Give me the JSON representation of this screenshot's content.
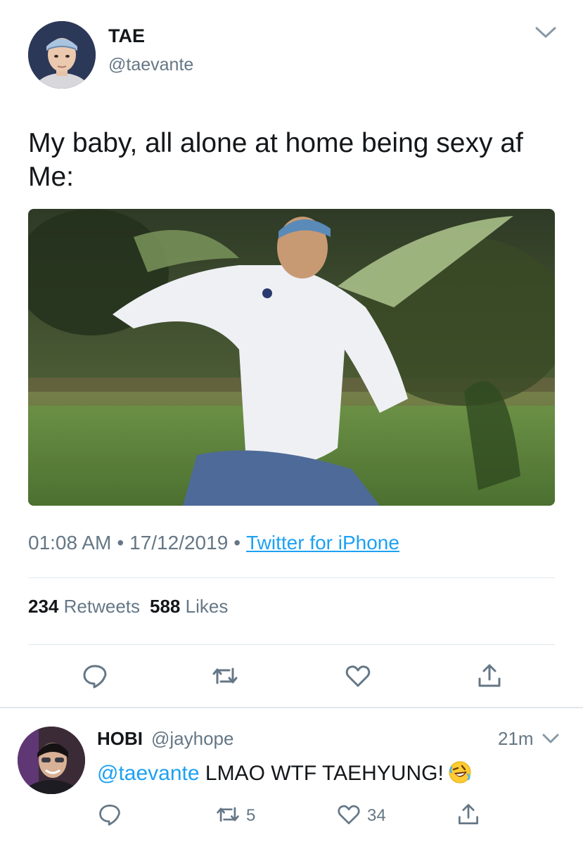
{
  "tweet": {
    "author_name": "TAE",
    "author_handle": "@taevante",
    "text_lines": [
      "My baby, all alone at home being sexy af",
      "Me:"
    ],
    "time": "01:08 AM",
    "separator": "•",
    "date": "17/12/2019",
    "source": "Twitter for iPhone",
    "retweet_count": "234",
    "retweet_label": "Retweets",
    "like_count": "588",
    "like_label": "Likes",
    "actions": [
      "reply-icon",
      "retweet-icon",
      "like-icon",
      "share-icon"
    ]
  },
  "reply": {
    "author_name": "HOBI",
    "author_handle": "@jayhope",
    "time": "21m",
    "mention": "@taevante",
    "text": " LMAO WTF TAEHYUNG!",
    "emoji": "rolling-on-floor-laughing-emoji",
    "retweet_count": "5",
    "like_count": "34"
  },
  "colors": {
    "text": "#14171a",
    "secondary": "#657786",
    "link": "#1da1f2",
    "divider": "#e1e8ed"
  }
}
